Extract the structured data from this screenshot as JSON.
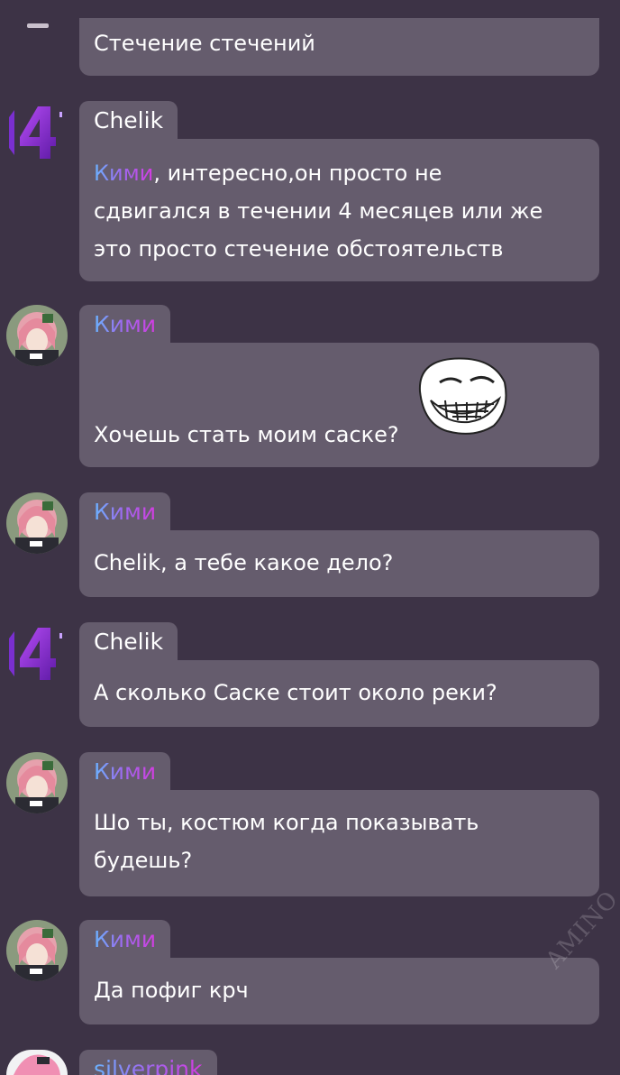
{
  "messages": [
    {
      "text": "Стечение стечений"
    },
    {
      "author": "Chelik",
      "mention": "Кими",
      "rest": ", интересно,он просто не",
      "line2": "сдвигался в течении 4 месяцев или же",
      "line3": "это просто стечение обстоятельств"
    },
    {
      "author": "Кими",
      "text": "Хочешь стать моим саске?"
    },
    {
      "author": "Кими",
      "text": "Chelik, а тебе какое дело?"
    },
    {
      "author": "Chelik",
      "text": "А сколько Саске стоит около реки?"
    },
    {
      "author": "Кими",
      "line1": "Шо ты, костюм когда показывать",
      "line2": "будешь?"
    },
    {
      "author": "Кими",
      "text": "Да пофиг крч"
    },
    {
      "author": "silverpink"
    }
  ],
  "icons": {
    "chelik_avatar": "purple-number-four-icon",
    "kimi_avatar": "pink-haired-anime-girl-avatar",
    "sticker": "trollface-sticker"
  },
  "colors": {
    "background": "#3d3346",
    "bubble": "#655c6d",
    "name_gradient_start": "#69b4ff",
    "name_gradient_end": "#d43be0",
    "four_purple": "#8a2be2"
  },
  "watermark": "AMINO"
}
